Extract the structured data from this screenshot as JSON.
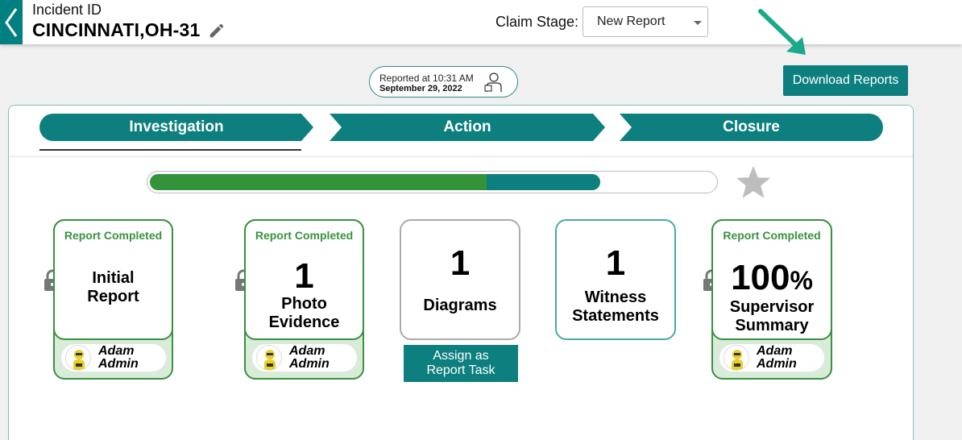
{
  "header": {
    "incident_label": "Incident ID",
    "incident_id": "CINCINNATI,OH-31",
    "claim_stage_label": "Claim Stage:",
    "claim_stage_value": "New Report"
  },
  "reported": {
    "time_line": "Reported at 10:31 AM",
    "date_line": "September 29, 2022"
  },
  "download_label": "Download Reports",
  "stages": [
    {
      "label": "Investigation",
      "active": true
    },
    {
      "label": "Action",
      "active": false
    },
    {
      "label": "Closure",
      "active": false
    }
  ],
  "progress": {
    "green_fraction": 0.595,
    "teal_fraction": 0.2
  },
  "cards": {
    "initial_report": {
      "status": "Report Completed",
      "line1": "Initial",
      "line2": "Report",
      "user_first": "Adam",
      "user_last": "Admin",
      "locked": true
    },
    "photo_evidence": {
      "status": "Report Completed",
      "count": "1",
      "line1": "Photo",
      "line2": "Evidence",
      "user_first": "Adam",
      "user_last": "Admin",
      "locked": true
    },
    "diagrams": {
      "count": "1",
      "line1": "Diagrams"
    },
    "witness": {
      "count": "1",
      "line1": "Witness",
      "line2": "Statements"
    },
    "supervisor": {
      "status": "Report Completed",
      "percent": "100",
      "percent_sign": "%",
      "line1": "Supervisor",
      "line2": "Summary",
      "user_first": "Adam",
      "user_last": "Admin",
      "locked": true
    }
  },
  "assign_button": {
    "line1": "Assign as",
    "line2": "Report Task"
  },
  "colors": {
    "teal": "#0e7f7f",
    "green": "#34923a",
    "annotation_arrow": "#1aa98a"
  },
  "icons": {
    "back": "chevron-left-icon",
    "edit": "pencil-icon",
    "reporter": "person-icon",
    "star": "star-icon",
    "lock": "lock-icon",
    "avatar": "user-avatar-icon"
  }
}
